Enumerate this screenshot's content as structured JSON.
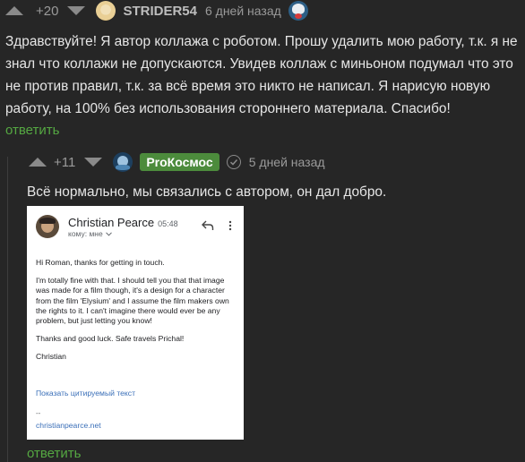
{
  "comment1": {
    "rating": "+20",
    "username": "STRIDER54",
    "date": "6 дней назад",
    "text": "Здравствуйте! Я автор коллажа с роботом. Прошу удалить мою работу, т.к. я не знал что коллажи не допускаются. Увидев коллаж с миньоном подумал что это не против правил, т.к. за всё время это никто не написал. Я нарисую новую работу, на 100% без использования стороннего материала. Спасибо!",
    "reply_label": "ответить"
  },
  "comment2": {
    "rating": "+11",
    "username": "ProКосмос",
    "date": "5 дней назад",
    "text": "Всё нормально, мы связались с автором, он дал добро.",
    "reply_label": "ответить"
  },
  "email": {
    "sender": "Christian Pearce",
    "time": "05:48",
    "to_label": "кому: мне",
    "paragraphs": [
      "Hi Roman, thanks for getting in touch.",
      "I'm totally fine with that. I should tell you that that image was made for a film though, it's a design for a character from the film 'Elysium' and I assume the film makers own the rights to it. I can't imagine there would ever be any problem, but just letting you know!",
      "Thanks and good luck. Safe travels Prichal!",
      "Christian"
    ],
    "show_quoted": "Показать цитируемый текст",
    "sig_dash": "--",
    "sig_link": "christianpearce.net"
  },
  "colors": {
    "background": "#262626",
    "reply_green": "#55a842",
    "tag_green": "#4c8b3c",
    "link_blue": "#3a6fb8"
  },
  "icons": [
    "upvote-icon",
    "downvote-icon",
    "avatar-icon",
    "verified-check-icon",
    "reply-arrow-icon",
    "more-vert-icon",
    "chevron-down-icon"
  ]
}
